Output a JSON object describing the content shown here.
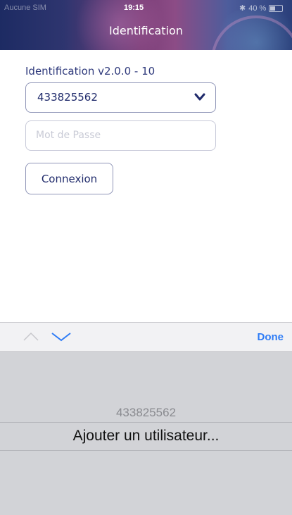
{
  "status_bar": {
    "carrier": "Aucune SIM",
    "time": "19:15",
    "battery": "40 %"
  },
  "header": {
    "title": "Identification"
  },
  "form": {
    "version_label": "Identification v2.0.0 - 10",
    "user_select_value": "433825562",
    "password_placeholder": "Mot de Passe",
    "login_button": "Connexion"
  },
  "keyboard_accessory": {
    "done_label": "Done"
  },
  "picker": {
    "options": [
      "433825562",
      "Ajouter un utilisateur..."
    ],
    "selected_index": 1
  },
  "colors": {
    "accent": "#2f3a7c",
    "done": "#2e7cf6"
  }
}
